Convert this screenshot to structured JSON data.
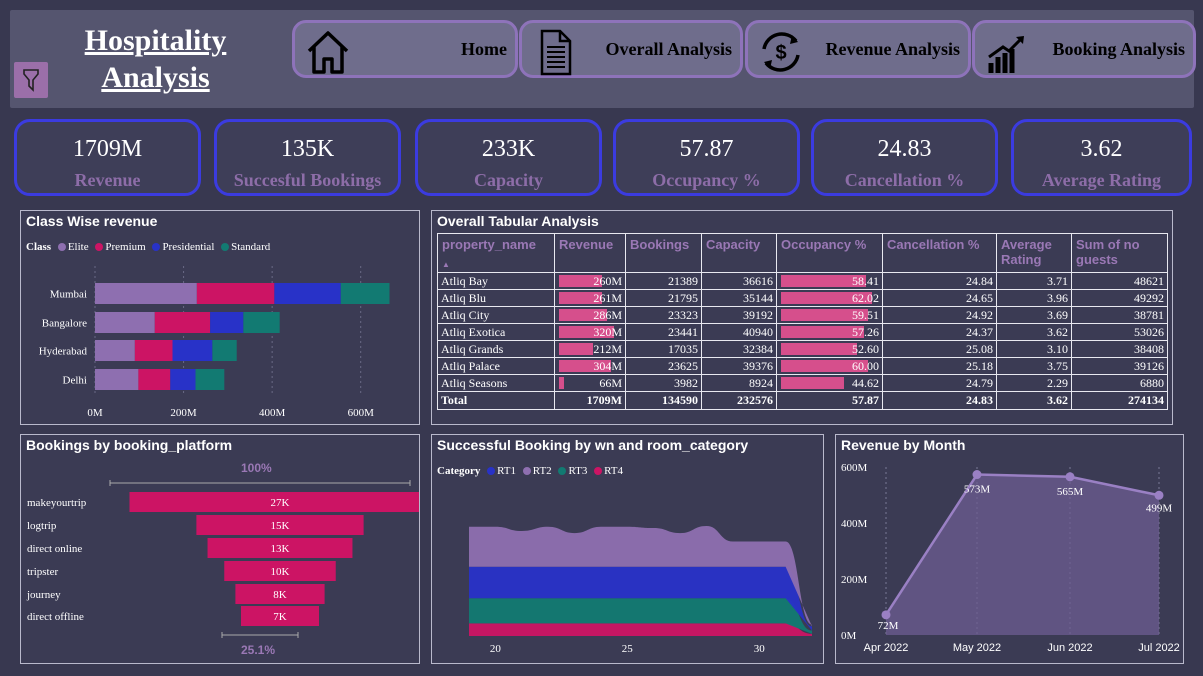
{
  "header": {
    "title_line1": "Hospitality",
    "title_line2": "Analysis",
    "nav": [
      {
        "label": "Home",
        "icon": "home-icon"
      },
      {
        "label": "Overall Analysis",
        "icon": "document-icon"
      },
      {
        "label": "Revenue Analysis",
        "icon": "dollar-cycle-icon"
      },
      {
        "label": "Booking Analysis",
        "icon": "bar-growth-icon"
      }
    ]
  },
  "kpis": [
    {
      "value": "1709M",
      "label": "Revenue"
    },
    {
      "value": "135K",
      "label": "Succesful Bookings"
    },
    {
      "value": "233K",
      "label": "Capacity"
    },
    {
      "value": "57.87",
      "label": "Occupancy %"
    },
    {
      "value": "24.83",
      "label": "Cancellation %"
    },
    {
      "value": "3.62",
      "label": "Average Rating"
    }
  ],
  "colors": {
    "elite": "#8e6fb0",
    "premium": "#cc1464",
    "presidential": "#2832c8",
    "standard": "#127a72",
    "accent": "#d64f8c"
  },
  "class_revenue": {
    "title": "Class Wise revenue",
    "legend_title": "Class",
    "legend": [
      "Elite",
      "Premium",
      "Presidential",
      "Standard"
    ],
    "x_ticks": [
      "0M",
      "200M",
      "400M",
      "600M"
    ]
  },
  "tabular": {
    "title": "Overall Tabular Analysis",
    "columns": [
      "property_name",
      "Revenue",
      "Bookings",
      "Capacity",
      "Occupancy %",
      "Cancellation %",
      "Average Rating",
      "Sum of no guests"
    ],
    "rows": [
      {
        "name": "Atliq Bay",
        "revenue": "260M",
        "rev_val": 260,
        "bookings": "21389",
        "capacity": "36616",
        "occupancy": "58.41",
        "occ_val": 58.41,
        "cancellation": "24.84",
        "rating": "3.71",
        "guests": "48621"
      },
      {
        "name": "Atliq Blu",
        "revenue": "261M",
        "rev_val": 261,
        "bookings": "21795",
        "capacity": "35144",
        "occupancy": "62.02",
        "occ_val": 62.02,
        "cancellation": "24.65",
        "rating": "3.96",
        "guests": "49292"
      },
      {
        "name": "Atliq City",
        "revenue": "286M",
        "rev_val": 286,
        "bookings": "23323",
        "capacity": "39192",
        "occupancy": "59.51",
        "occ_val": 59.51,
        "cancellation": "24.92",
        "rating": "3.69",
        "guests": "38781"
      },
      {
        "name": "Atliq Exotica",
        "revenue": "320M",
        "rev_val": 320,
        "bookings": "23441",
        "capacity": "40940",
        "occupancy": "57.26",
        "occ_val": 57.26,
        "cancellation": "24.37",
        "rating": "3.62",
        "guests": "53026"
      },
      {
        "name": "Atliq Grands",
        "revenue": "212M",
        "rev_val": 212,
        "bookings": "17035",
        "capacity": "32384",
        "occupancy": "52.60",
        "occ_val": 52.6,
        "cancellation": "25.08",
        "rating": "3.10",
        "guests": "38408"
      },
      {
        "name": "Atliq Palace",
        "revenue": "304M",
        "rev_val": 304,
        "bookings": "23625",
        "capacity": "39376",
        "occupancy": "60.00",
        "occ_val": 60.0,
        "cancellation": "25.18",
        "rating": "3.75",
        "guests": "39126"
      },
      {
        "name": "Atliq Seasons",
        "revenue": "66M",
        "rev_val": 66,
        "bookings": "3982",
        "capacity": "8924",
        "occupancy": "44.62",
        "occ_val": 44.62,
        "cancellation": "24.79",
        "rating": "2.29",
        "guests": "6880"
      }
    ],
    "total": {
      "name": "Total",
      "revenue": "1709M",
      "bookings": "134590",
      "capacity": "232576",
      "occupancy": "57.87",
      "cancellation": "24.83",
      "rating": "3.62",
      "guests": "274134"
    }
  },
  "funnel": {
    "title": "Bookings by booking_platform",
    "top_pct": "100%",
    "bottom_pct": "25.1%"
  },
  "stream": {
    "title": "Successful Booking by wn and room_category",
    "legend_title": "Category",
    "legend": [
      "RT1",
      "RT2",
      "RT3",
      "RT4"
    ],
    "x_ticks": [
      "20",
      "25",
      "30"
    ]
  },
  "monthly": {
    "title": "Revenue by Month",
    "y_ticks": [
      "600M",
      "400M",
      "200M",
      "0M"
    ]
  },
  "chart_data": [
    {
      "type": "bar",
      "title": "Class Wise revenue",
      "orientation": "horizontal",
      "stacked": true,
      "categories": [
        "Mumbai",
        "Bangalore",
        "Hyderabad",
        "Delhi"
      ],
      "series": [
        {
          "name": "Elite",
          "values": [
            230,
            135,
            90,
            98
          ]
        },
        {
          "name": "Premium",
          "values": [
            175,
            125,
            85,
            72
          ]
        },
        {
          "name": "Presidential",
          "values": [
            150,
            75,
            90,
            57
          ]
        },
        {
          "name": "Standard",
          "values": [
            110,
            82,
            55,
            65
          ]
        }
      ],
      "xlim": [
        0,
        700
      ]
    },
    {
      "type": "bar",
      "title": "Bookings by booking_platform",
      "orientation": "funnel",
      "categories": [
        "makeyourtrip",
        "logtrip",
        "direct online",
        "tripster",
        "journey",
        "direct offline"
      ],
      "values": [
        27,
        15,
        13,
        10,
        8,
        7
      ],
      "labels": [
        "27K",
        "15K",
        "13K",
        "10K",
        "8K",
        "7K"
      ]
    },
    {
      "type": "area",
      "title": "Successful Booking by wn and room_category",
      "stacked": true,
      "x": [
        19,
        20,
        21,
        22,
        23,
        24,
        25,
        26,
        27,
        28,
        29,
        30,
        31,
        32
      ],
      "series": [
        {
          "name": "RT4",
          "values": [
            30,
            30,
            30,
            30,
            30,
            30,
            30,
            30,
            30,
            30,
            30,
            30,
            30,
            5
          ]
        },
        {
          "name": "RT3",
          "values": [
            60,
            60,
            60,
            60,
            60,
            60,
            60,
            60,
            60,
            60,
            60,
            60,
            60,
            8
          ]
        },
        {
          "name": "RT1",
          "values": [
            75,
            75,
            75,
            75,
            75,
            75,
            75,
            75,
            75,
            75,
            75,
            75,
            75,
            10
          ]
        },
        {
          "name": "RT2",
          "values": [
            95,
            95,
            85,
            95,
            80,
            95,
            95,
            92,
            80,
            97,
            60,
            60,
            60,
            4
          ]
        }
      ]
    },
    {
      "type": "area",
      "title": "Revenue by Month",
      "categories": [
        "Apr 2022",
        "May 2022",
        "Jun 2022",
        "Jul 2022"
      ],
      "values": [
        72,
        573,
        565,
        499
      ],
      "labels": [
        "72M",
        "573M",
        "565M",
        "499M"
      ],
      "ylim": [
        0,
        600
      ]
    }
  ]
}
